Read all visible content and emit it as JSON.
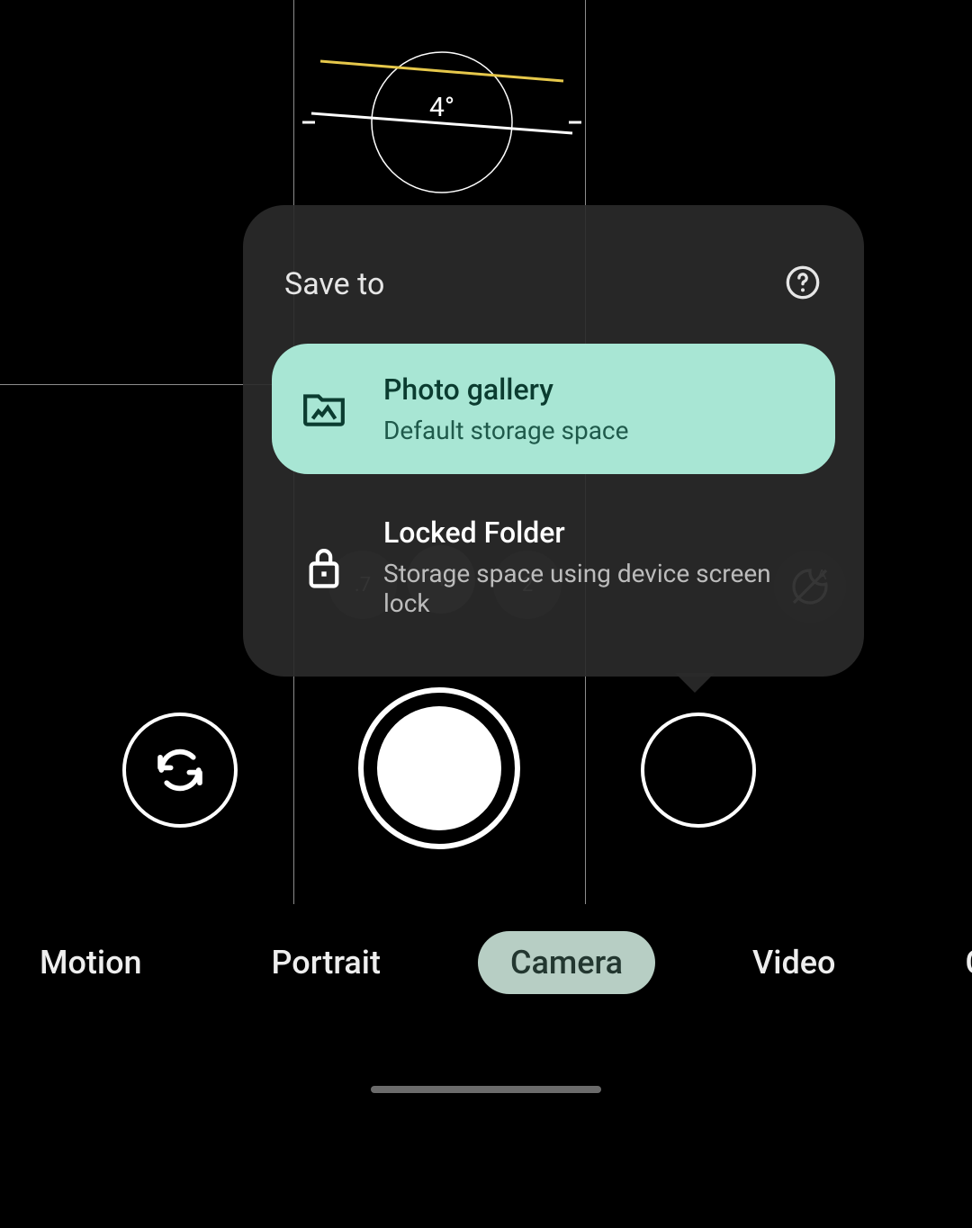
{
  "level": {
    "degrees": "4°"
  },
  "popup": {
    "title": "Save to",
    "options": [
      {
        "title": "Photo gallery",
        "subtitle": "Default storage space",
        "selected": true
      },
      {
        "title": "Locked Folder",
        "subtitle": "Storage space using device screen lock",
        "selected": false
      }
    ]
  },
  "zoom": {
    "left": ".7",
    "center": "1",
    "right": "2"
  },
  "modes": {
    "items": [
      "Motion",
      "Portrait",
      "Camera",
      "Video",
      "Cinemat"
    ],
    "active_index": 2
  }
}
